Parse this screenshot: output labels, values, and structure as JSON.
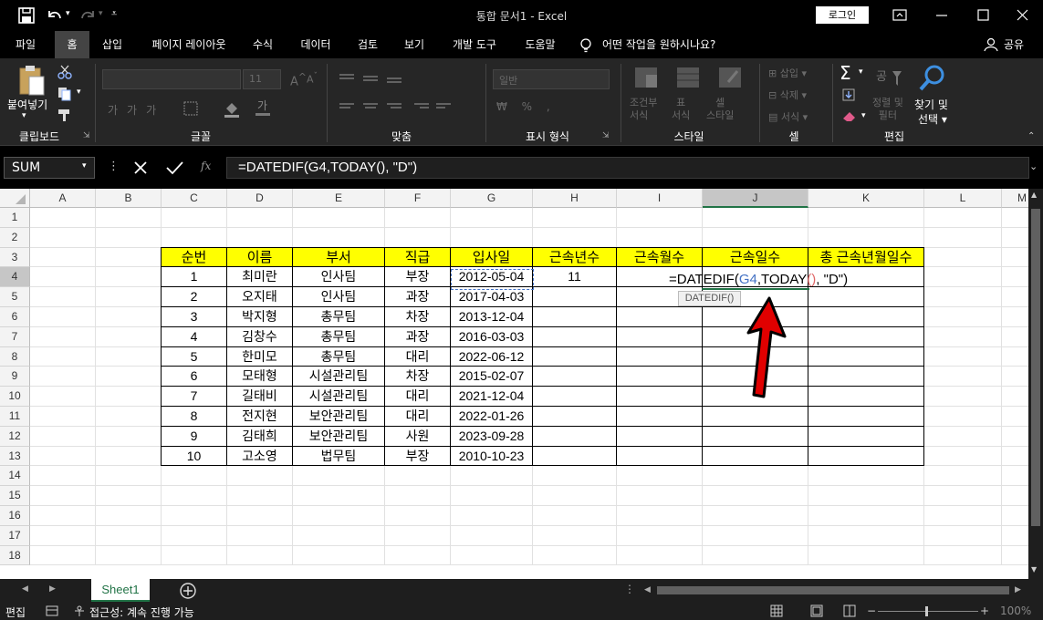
{
  "window": {
    "title": "통합 문서1  -  Excel",
    "login_label": "로그인"
  },
  "tabs": [
    "파일",
    "홈",
    "삽입",
    "페이지 레이아웃",
    "수식",
    "데이터",
    "검토",
    "보기",
    "개발 도구",
    "도움말"
  ],
  "active_tab": "홈",
  "tell_me": "어떤 작업을 원하시나요?",
  "share_label": "공유",
  "ribbon": {
    "paste_label": "붙여넣기",
    "clipboard_label": "클립보드",
    "font_label": "글꼴",
    "font_size": "11",
    "align_label": "맞춤",
    "number_format": "일반",
    "number_label": "표시 형식",
    "cond_format": "조건부\n서식",
    "table_format": "표\n서식",
    "cell_style": "셀\n스타일",
    "style_label": "스타일",
    "insert_label": "삽입",
    "delete_label": "삭제",
    "format_label": "서식",
    "cells_label": "셀",
    "sort_filter": "정렬 및\n필터",
    "find_select_1": "찾기 및",
    "find_select_2": "선택",
    "edit_label": "편집"
  },
  "formula_bar": {
    "name_box": "SUM",
    "formula": "=DATEDIF(G4,TODAY(), \"D\")",
    "fx": "fx"
  },
  "columns": [
    "A",
    "B",
    "C",
    "D",
    "E",
    "F",
    "G",
    "H",
    "I",
    "J",
    "K",
    "L",
    "M"
  ],
  "rows": [
    "1",
    "2",
    "3",
    "4",
    "5",
    "6",
    "7",
    "8",
    "9",
    "10",
    "11",
    "12",
    "13",
    "14",
    "15",
    "16",
    "17",
    "18"
  ],
  "table": {
    "headers": [
      "순번",
      "이름",
      "부서",
      "직급",
      "입사일",
      "근속년수",
      "근속월수",
      "근속일수",
      "총 근속년월일수"
    ],
    "rows": [
      [
        "1",
        "최미란",
        "인사팀",
        "부장",
        "2012-05-04",
        "11"
      ],
      [
        "2",
        "오지태",
        "인사팀",
        "과장",
        "2017-04-03",
        ""
      ],
      [
        "3",
        "박지형",
        "총무팀",
        "차장",
        "2013-12-04",
        ""
      ],
      [
        "4",
        "김창수",
        "총무팀",
        "과장",
        "2016-03-03",
        ""
      ],
      [
        "5",
        "한미모",
        "총무팀",
        "대리",
        "2022-06-12",
        ""
      ],
      [
        "6",
        "모태형",
        "시설관리팀",
        "차장",
        "2015-02-07",
        ""
      ],
      [
        "7",
        "길태비",
        "시설관리팀",
        "대리",
        "2021-12-04",
        ""
      ],
      [
        "8",
        "전지현",
        "보안관리팀",
        "대리",
        "2022-01-26",
        ""
      ],
      [
        "9",
        "김태희",
        "보안관리팀",
        "사원",
        "2023-09-28",
        ""
      ],
      [
        "10",
        "고소영",
        "법무팀",
        "부장",
        "2010-10-23",
        ""
      ]
    ]
  },
  "edit_cell": {
    "prefix": "=DATEDIF(",
    "ref": "G4",
    "mid": ",TODAY",
    "paren": "()",
    "suffix": ", \"D\")",
    "tooltip": "DATEDIF()"
  },
  "colors": {
    "header_fill": "#ffff00",
    "ref_blue": "#4472c4",
    "paren_red": "#e06666",
    "arrow_red": "#e00000",
    "excel_green": "#217346"
  },
  "sheet_tab": "Sheet1",
  "status": {
    "mode": "편집",
    "accessibility": "접근성: 계속 진행 가능",
    "zoom": "100%"
  }
}
